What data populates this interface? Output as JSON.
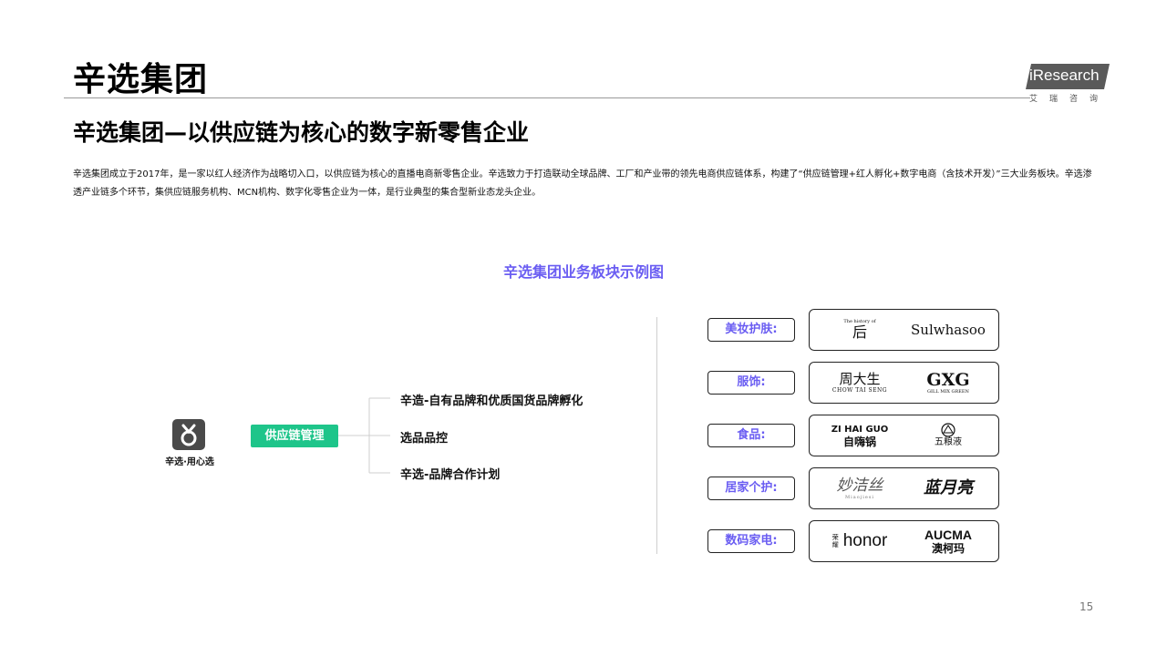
{
  "header": {
    "title": "辛选集团",
    "logo_text": "iResearch",
    "logo_sub": "艾瑞咨询"
  },
  "subtitle": "辛选集团—以供应链为核心的数字新零售企业",
  "description": "辛选集团成立于2017年，是一家以红人经济作为战略切入口，以供应链为核心的直播电商新零售企业。辛选致力于打造联动全球品牌、工厂和产业带的领先电商供应链体系，构建了“供应链管理+红人孵化+数字电商（含技术开发）”三大业务板块。辛选渗透产业链多个环节，集供应链服务机构、MCN机构、数字化零售企业为一体，是行业典型的集合型新业态龙头企业。",
  "diagram": {
    "title": "辛选集团业务板块示例图",
    "app_name": "辛选·用心选",
    "root_label": "供应链管理",
    "branches": [
      "辛造-自有品牌和优质国货品牌孵化",
      "选品品控",
      "辛选-品牌合作计划"
    ],
    "categories": [
      {
        "label": "美妆护肤:",
        "brands": [
          {
            "lines": [
              "The history of",
              "后"
            ]
          },
          {
            "lines": [
              "Sulwhasoo"
            ]
          }
        ]
      },
      {
        "label": "服饰:",
        "brands": [
          {
            "lines": [
              "周大生",
              "CHOW TAI SENG"
            ]
          },
          {
            "lines": [
              "GXG",
              "GILL MIX GREEN"
            ]
          }
        ]
      },
      {
        "label": "食品:",
        "brands": [
          {
            "lines": [
              "ZI HAI GUO",
              "自嗨锅"
            ]
          },
          {
            "lines": [
              "五粮液"
            ]
          }
        ]
      },
      {
        "label": "居家个护:",
        "brands": [
          {
            "lines": [
              "妙洁丝",
              "Miaojiesi"
            ]
          },
          {
            "lines": [
              "蓝月亮"
            ]
          }
        ]
      },
      {
        "label": "数码家电:",
        "brands": [
          {
            "lines": [
              "荣耀",
              "honor"
            ]
          },
          {
            "lines": [
              "AUCMA",
              "澳柯玛"
            ]
          }
        ]
      }
    ]
  },
  "page_number": "15",
  "colors": {
    "accent_purple": "#6a5df2",
    "accent_green": "#1ec58a",
    "logo_gray": "#5a5a5a"
  }
}
